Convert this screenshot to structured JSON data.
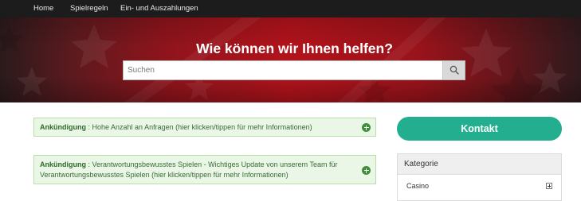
{
  "nav": {
    "items": [
      {
        "label": "Home"
      },
      {
        "label": "Spielregeln"
      },
      {
        "label": "Ein- und Auszahlungen"
      }
    ]
  },
  "hero": {
    "title": "Wie können wir Ihnen helfen?",
    "search_placeholder": "Suchen",
    "search_icon": "search-icon"
  },
  "announcements": [
    {
      "title": "Ankündigung",
      "separator": " : ",
      "text": "Hohe Anzahl an Anfragen (hier klicken/tippen für mehr Informationen)",
      "icon": "plus-circle-icon"
    },
    {
      "title": "Ankündigung",
      "separator": " : ",
      "text": "Verantwortungsbewusstes Spielen - Wichtiges Update von unserem Team für Verantwortungsbewusstes Spielen (hier klicken/tippen für mehr Informationen)",
      "icon": "plus-circle-icon"
    }
  ],
  "sidebar": {
    "contact_label": "Kontakt",
    "category": {
      "heading": "Kategorie",
      "items": [
        {
          "label": "Casino",
          "icon": "expand-plus-icon"
        }
      ]
    }
  },
  "colors": {
    "nav_bg": "#1c1c1c",
    "hero_red": "#b3131b",
    "contact_green": "#23ae8f",
    "announcement_bg": "#eaf6e6",
    "announcement_border": "#b7dfaa",
    "announcement_icon": "#3f8f3a"
  }
}
